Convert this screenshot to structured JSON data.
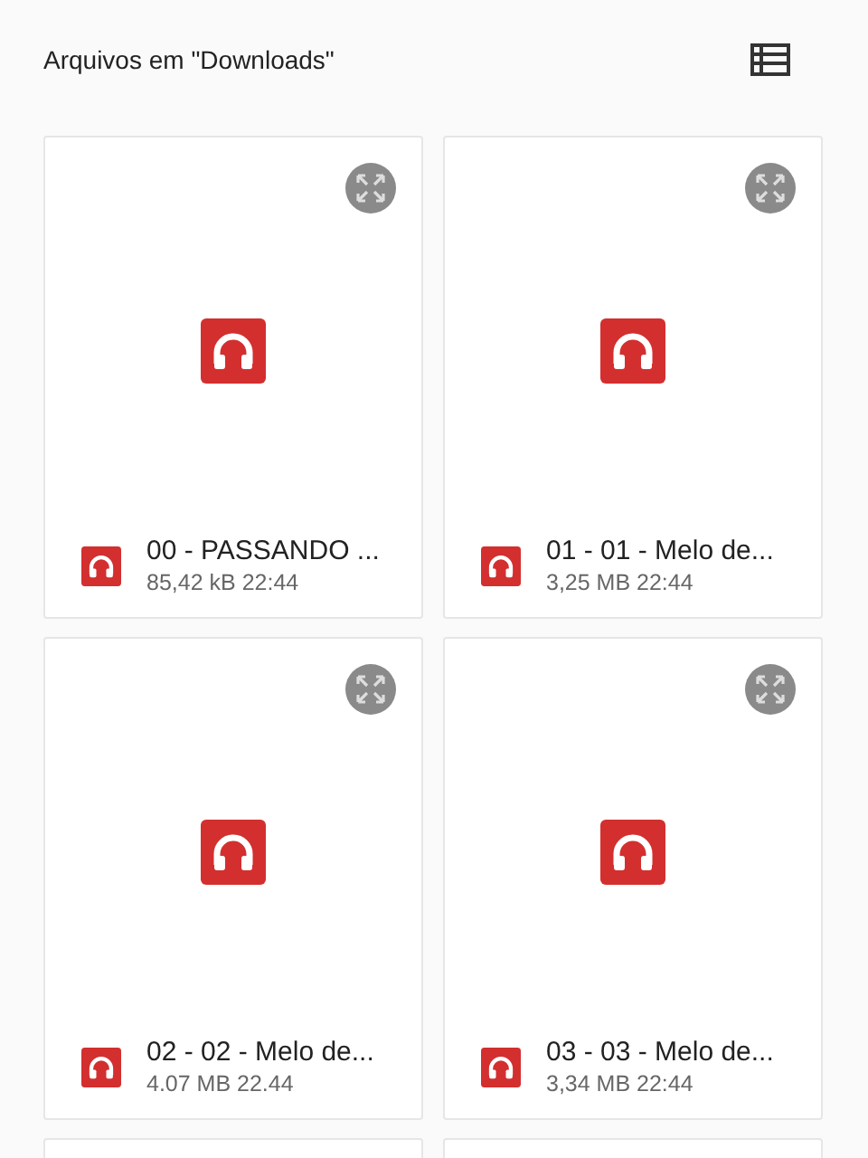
{
  "header": {
    "title": "Arquivos em \"Downloads\""
  },
  "files": [
    {
      "name": "00 - PASSANDO ...",
      "meta": "85,42 kB 22:44"
    },
    {
      "name": "01 - 01 - Melo de...",
      "meta": "3,25 MB 22:44"
    },
    {
      "name": "02 - 02 - Melo de...",
      "meta": "4.07 MB 22.44"
    },
    {
      "name": "03 - 03 - Melo de...",
      "meta": "3,34 MB 22:44"
    }
  ]
}
